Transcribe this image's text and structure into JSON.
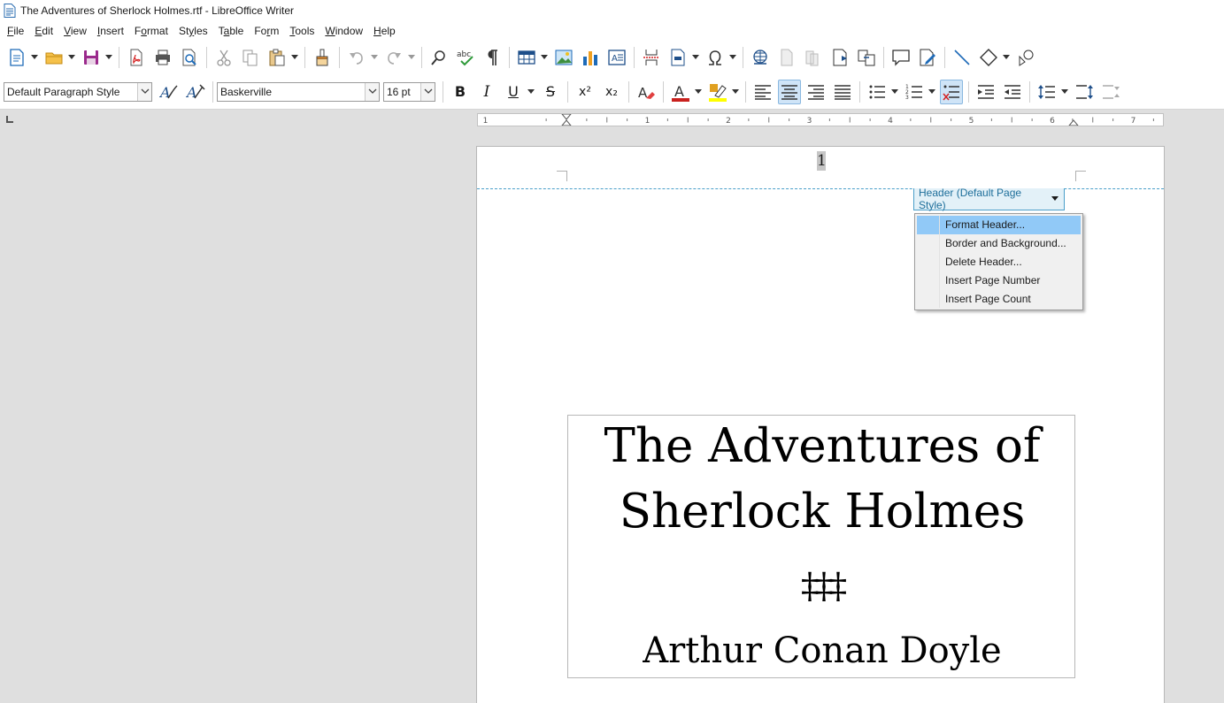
{
  "window": {
    "title": "The Adventures of Sherlock Holmes.rtf - LibreOffice Writer"
  },
  "menu": [
    {
      "pre": "",
      "u": "F",
      "post": "ile"
    },
    {
      "pre": "",
      "u": "E",
      "post": "dit"
    },
    {
      "pre": "",
      "u": "V",
      "post": "iew"
    },
    {
      "pre": "",
      "u": "I",
      "post": "nsert"
    },
    {
      "pre": "F",
      "u": "o",
      "post": "rmat"
    },
    {
      "pre": "St",
      "u": "y",
      "post": "les"
    },
    {
      "pre": "T",
      "u": "a",
      "post": "ble"
    },
    {
      "pre": "Fo",
      "u": "r",
      "post": "m"
    },
    {
      "pre": "",
      "u": "T",
      "post": "ools"
    },
    {
      "pre": "",
      "u": "W",
      "post": "indow"
    },
    {
      "pre": "",
      "u": "H",
      "post": "elp"
    }
  ],
  "formatting": {
    "paragraph_style": "Default Paragraph Style",
    "font_name": "Baskerville",
    "font_size": "16 pt",
    "bold": "B",
    "italic": "I",
    "underline": "U",
    "strike": "S",
    "superscript": "x²",
    "subscript": "x₂"
  },
  "ruler": {
    "labels": [
      "1",
      "1",
      "2",
      "3",
      "4",
      "5",
      "6",
      "7"
    ]
  },
  "page": {
    "page_number": "1",
    "header_tag": "Header (Default Page Style)",
    "title_line1": "The Adventures of",
    "title_line2": "Sherlock Holmes",
    "ornament": "‡‡‡",
    "author": "Arthur Conan Doyle"
  },
  "context_menu": {
    "items": [
      "Format Header...",
      "Border and Background...",
      "Delete Header...",
      "Insert Page Number",
      "Insert Page Count"
    ],
    "highlighted": 0
  },
  "colors": {
    "accent": "#4a9ec9",
    "highlight": "#91c9f7",
    "font_color": "#c9211e",
    "highlight_color": "#ffff00"
  }
}
